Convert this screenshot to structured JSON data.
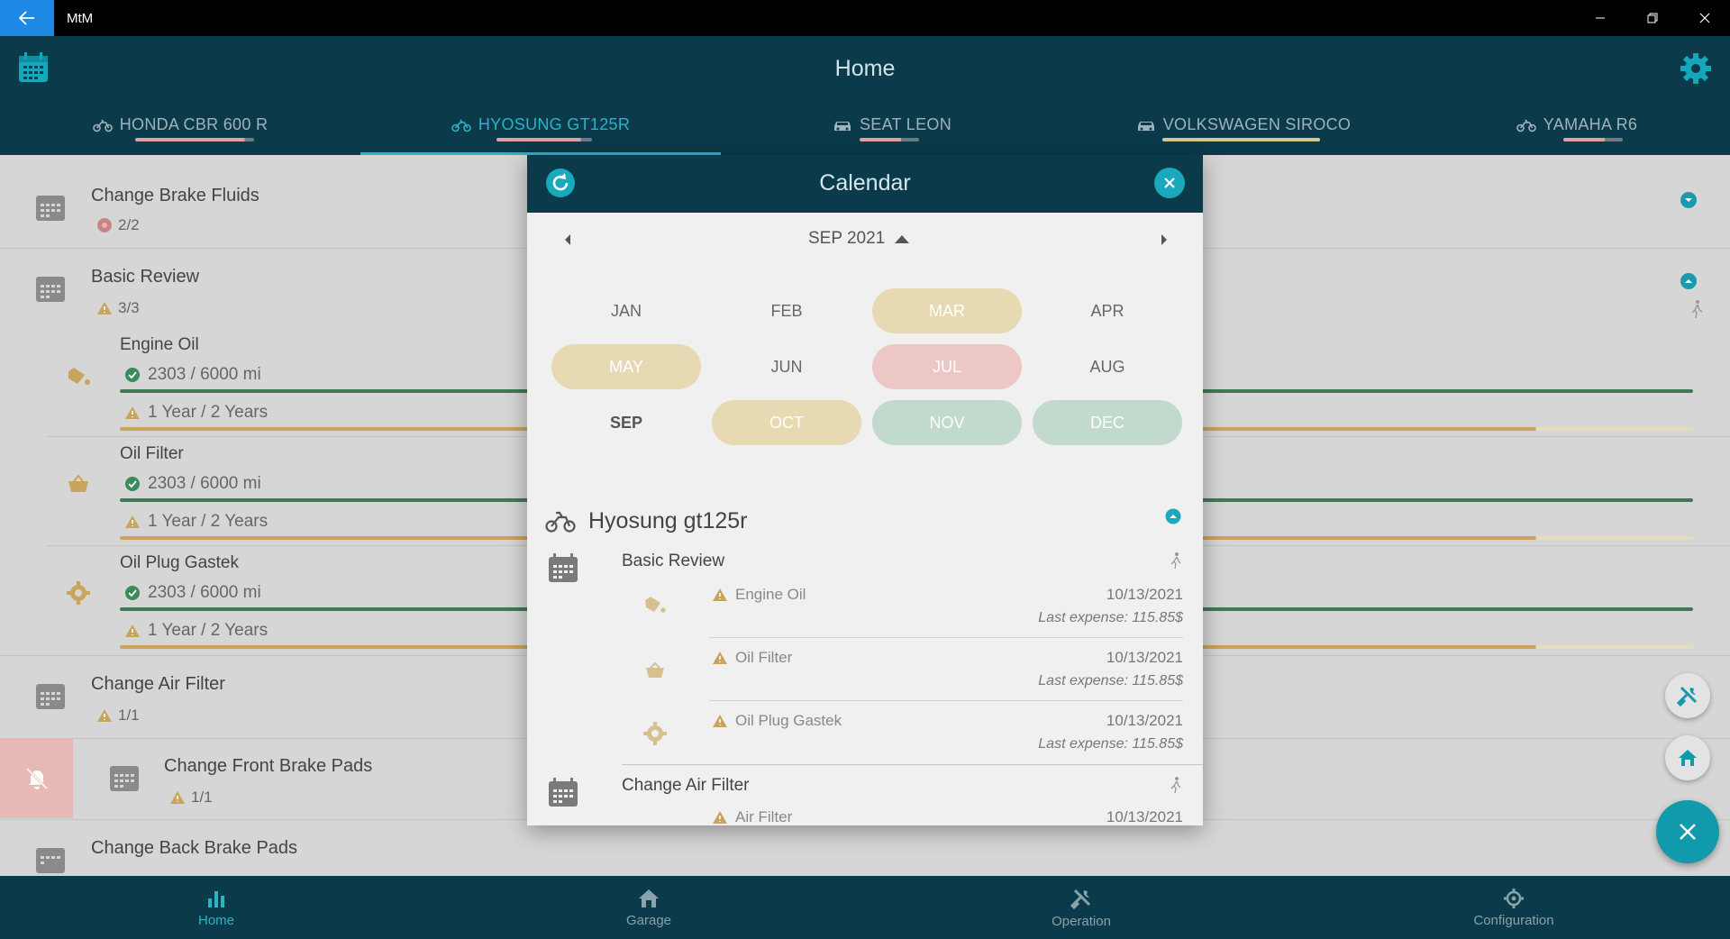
{
  "window": {
    "title": "MtM"
  },
  "header": {
    "title": "Home"
  },
  "tabs": [
    {
      "label": "HONDA CBR 600 R",
      "icon": "motorcycle-icon"
    },
    {
      "label": "HYOSUNG GT125R",
      "icon": "motorcycle-icon"
    },
    {
      "label": "SEAT LEON",
      "icon": "car-icon"
    },
    {
      "label": "VOLKSWAGEN SIROCO",
      "icon": "car-icon"
    },
    {
      "label": "YAMAHA R6",
      "icon": "motorcycle-icon"
    }
  ],
  "list": {
    "change_brake_fluids": {
      "title": "Change Brake Fluids",
      "count": "2/2"
    },
    "basic_review": {
      "title": "Basic Review",
      "count": "3/3",
      "items": [
        {
          "title": "Engine Oil",
          "distance": "2303 / 6000 mi",
          "time": "1 Year / 2 Years"
        },
        {
          "title": "Oil Filter",
          "distance": "2303 / 6000 mi",
          "time": "1 Year / 2 Years"
        },
        {
          "title": "Oil Plug Gastek",
          "distance": "2303 / 6000 mi",
          "time": "1 Year / 2 Years"
        }
      ]
    },
    "change_air_filter": {
      "title": "Change Air Filter",
      "count": "1/1"
    },
    "change_front_brake_pads": {
      "title": "Change Front Brake Pads",
      "count": "1/1"
    },
    "change_back_brake_pads": {
      "title": "Change Back Brake Pads"
    }
  },
  "dialog": {
    "title": "Calendar",
    "month_label": "SEP 2021",
    "months": [
      "JAN",
      "FEB",
      "MAR",
      "APR",
      "MAY",
      "JUN",
      "JUL",
      "AUG",
      "SEP",
      "OCT",
      "NOV",
      "DEC"
    ],
    "vehicle": "Hyosung gt125r",
    "sections": [
      {
        "title": "Basic Review",
        "items": [
          {
            "name": "Engine Oil",
            "date": "10/13/2021",
            "expense": "Last expense: 115.85$"
          },
          {
            "name": "Oil Filter",
            "date": "10/13/2021",
            "expense": "Last expense: 115.85$"
          },
          {
            "name": "Oil Plug Gastek",
            "date": "10/13/2021",
            "expense": "Last expense: 115.85$"
          }
        ]
      },
      {
        "title": "Change Air Filter",
        "items": [
          {
            "name": "Air Filter",
            "date": "10/13/2021"
          }
        ]
      }
    ]
  },
  "bottom_nav": [
    {
      "label": "Home",
      "icon": "bar-chart-icon"
    },
    {
      "label": "Garage",
      "icon": "garage-icon"
    },
    {
      "label": "Operation",
      "icon": "tools-icon"
    },
    {
      "label": "Configuration",
      "icon": "gear-icon"
    }
  ],
  "colors": {
    "header_bg": "#0b3a4a",
    "accent": "#2bb3c8",
    "warn_beige": "#e7d9b2",
    "alert_pink": "#ecc7c5",
    "ok_green": "#c2d9cd"
  }
}
